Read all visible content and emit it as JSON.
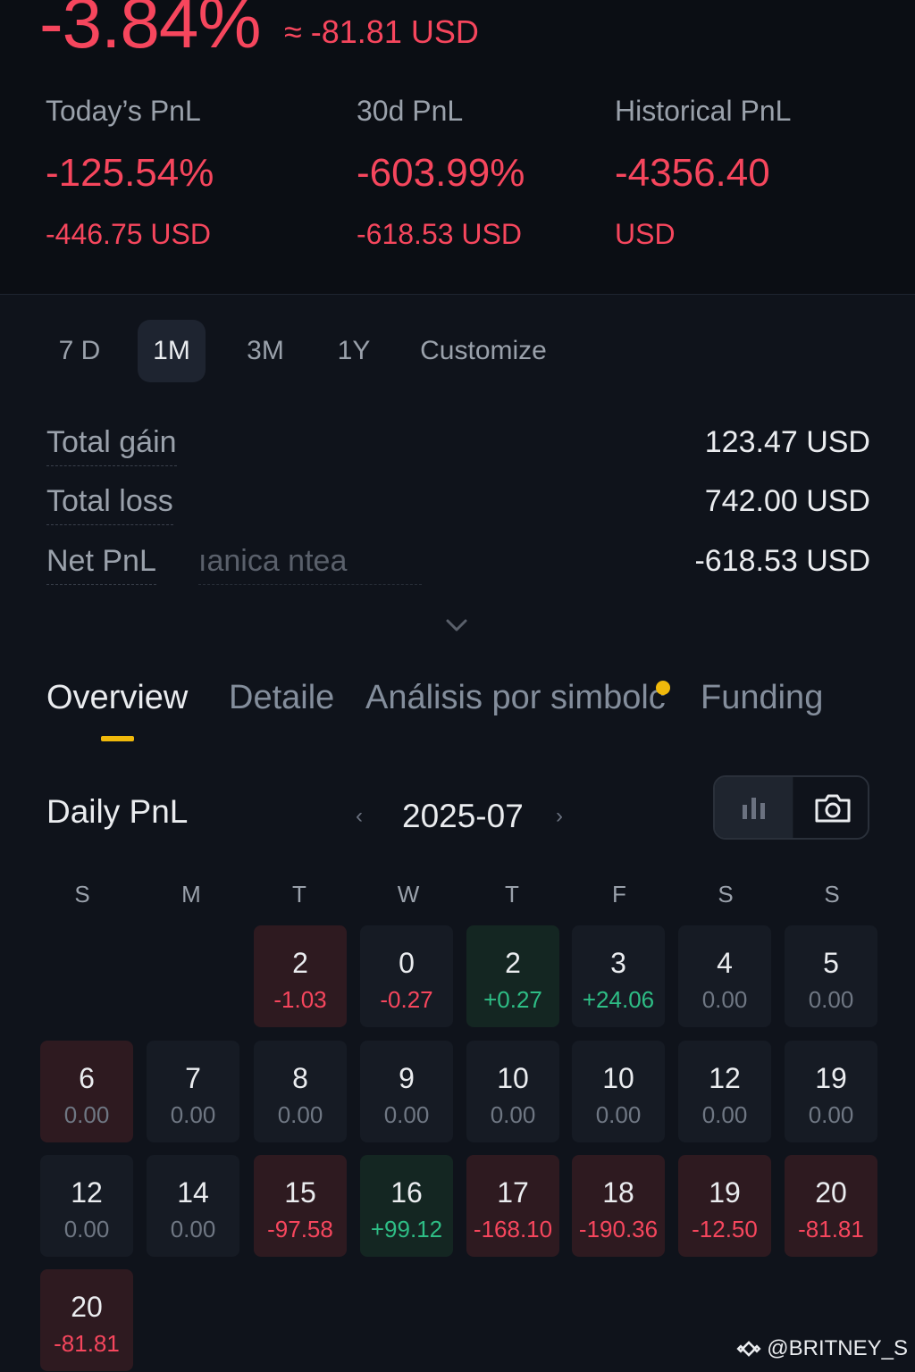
{
  "header": {
    "big_pct": "-3.84%",
    "big_usd": "≈ -81.81 USD",
    "stats": [
      {
        "label": "Today’s PnL",
        "pct": "-125.54%",
        "usd": "-446.75 USD"
      },
      {
        "label": "30d PnL",
        "pct": "-603.99%",
        "usd": "-618.53 USD"
      },
      {
        "label": "Historical PnL",
        "pct": "-4356.40",
        "usd": "USD"
      }
    ]
  },
  "ranges": [
    "7 D",
    "1M",
    "3M",
    "1Y",
    "Customize"
  ],
  "active_range": "1M",
  "summary": {
    "gain_label": "Total gáin",
    "gain_value": "123.47 USD",
    "loss_label": "Total loss",
    "loss_value": "742.00 USD",
    "net_label": "Net PnL",
    "net_ghost": "ıanica ntea",
    "net_value": "-618.53 USD"
  },
  "tabs": [
    "Overview",
    "Detaile",
    "Análisis por simbolc",
    "Funding"
  ],
  "active_tab": "Overview",
  "daily": {
    "title": "Daily PnL",
    "month": "2025-07",
    "prev_arrow": "‹",
    "next_arrow": "›"
  },
  "weekdays": [
    "S",
    "M",
    "T",
    "W",
    "T",
    "F",
    "S",
    "S"
  ],
  "calendar": [
    {
      "day": "2",
      "val": "-1.03",
      "tone": "red"
    },
    {
      "day": "0",
      "val": "-0.27",
      "tone": "neutral-neg"
    },
    {
      "day": "2",
      "val": "+0.27",
      "tone": "green"
    },
    {
      "day": "3",
      "val": "+24.06",
      "tone": "neutral-pos"
    },
    {
      "day": "4",
      "val": "0.00",
      "tone": "neutral"
    },
    {
      "day": "5",
      "val": "0.00",
      "tone": "neutral"
    },
    {
      "day": "6",
      "val": "0.00",
      "tone": "red"
    },
    {
      "day": "7",
      "val": "0.00",
      "tone": "neutral"
    },
    {
      "day": "8",
      "val": "0.00",
      "tone": "neutral"
    },
    {
      "day": "9",
      "val": "0.00",
      "tone": "neutral"
    },
    {
      "day": "10",
      "val": "0.00",
      "tone": "neutral"
    },
    {
      "day": "10",
      "val": "0.00",
      "tone": "neutral"
    },
    {
      "day": "12",
      "val": "0.00",
      "tone": "neutral"
    },
    {
      "day": "19",
      "val": "0.00",
      "tone": "neutral"
    },
    {
      "day": "12",
      "val": "0.00",
      "tone": "neutral"
    },
    {
      "day": "14",
      "val": "0.00",
      "tone": "neutral"
    },
    {
      "day": "15",
      "val": "-97.58",
      "tone": "red"
    },
    {
      "day": "16",
      "val": "+99.12",
      "tone": "green"
    },
    {
      "day": "17",
      "val": "-168.10",
      "tone": "red"
    },
    {
      "day": "18",
      "val": "-190.36",
      "tone": "red"
    },
    {
      "day": "19",
      "val": "-12.50",
      "tone": "red"
    },
    {
      "day": "20",
      "val": "-81.81",
      "tone": "red"
    },
    {
      "day": "20",
      "val": "-81.81",
      "tone": "red"
    }
  ],
  "watermark": "@BRITNEY_S",
  "colors": {
    "loss": "#f6465d",
    "gain": "#2ebd85",
    "accent": "#f0b90b",
    "background": "#0f131b"
  },
  "icons": [
    "chevron-down-icon",
    "bar-chart-icon",
    "camera-icon",
    "binance-logo-icon"
  ]
}
